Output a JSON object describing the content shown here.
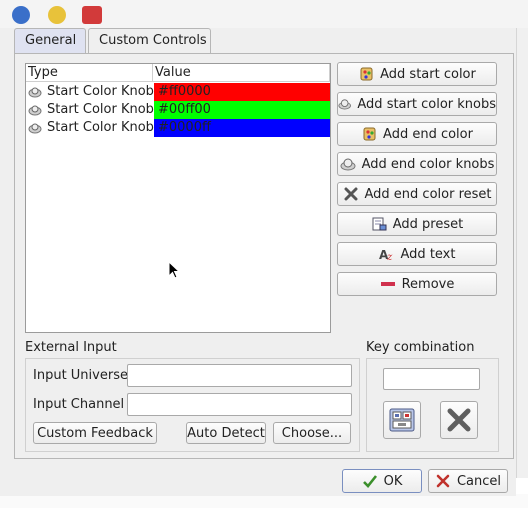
{
  "tabs": [
    {
      "label": "General",
      "active": false
    },
    {
      "label": "Custom Controls",
      "active": true
    }
  ],
  "table": {
    "headers": [
      "Type",
      "Value"
    ],
    "rows": [
      {
        "type": "Start Color Knob",
        "value": "#ff0000",
        "color": "#ff0000"
      },
      {
        "type": "Start Color Knob",
        "value": "#00ff00",
        "color": "#00ff00"
      },
      {
        "type": "Start Color Knob",
        "value": "#0000ff",
        "color": "#0000ff"
      }
    ]
  },
  "buttons": {
    "add_start_color": "Add start color",
    "add_start_color_knobs": "Add start color knobs",
    "add_end_color": "Add end color",
    "add_end_color_knobs": "Add end color knobs",
    "add_end_color_reset": "Add end color reset",
    "add_preset": "Add preset",
    "add_text": "Add text",
    "remove": "Remove"
  },
  "external_input": {
    "title": "External Input",
    "universe_label": "Input Universe",
    "universe_value": "",
    "channel_label": "Input Channel",
    "channel_value": "",
    "custom_feedback": "Custom Feedback",
    "auto_detect": "Auto Detect",
    "choose": "Choose..."
  },
  "key_combination": {
    "title": "Key combination",
    "value": ""
  },
  "footer": {
    "ok": "OK",
    "cancel": "Cancel"
  }
}
